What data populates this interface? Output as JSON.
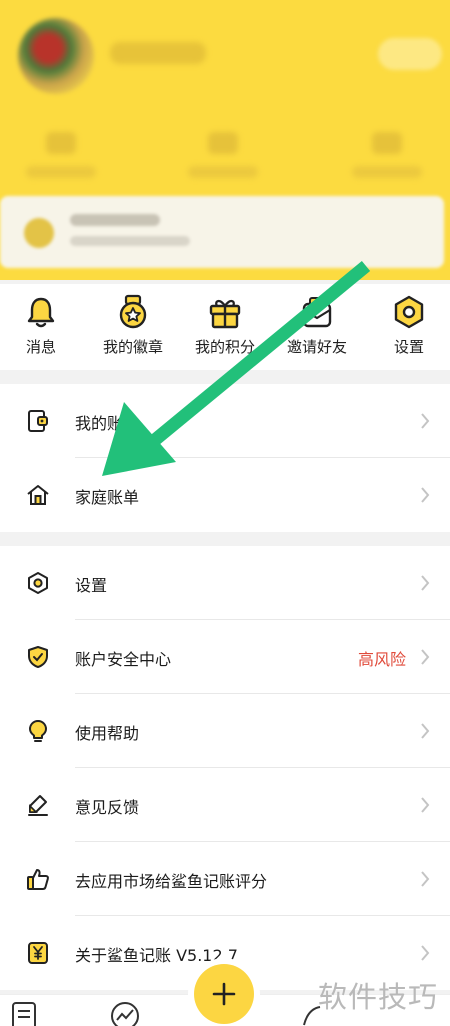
{
  "colors": {
    "brand_yellow": "#fcdb40",
    "risk_red": "#e04a3a",
    "annotation_arrow": "#22c07a"
  },
  "quick_actions": [
    {
      "label": "消息",
      "icon": "bell-icon"
    },
    {
      "label": "我的徽章",
      "icon": "medal-icon"
    },
    {
      "label": "我的积分",
      "icon": "gift-icon"
    },
    {
      "label": "邀请好友",
      "icon": "invite-icon"
    },
    {
      "label": "设置",
      "icon": "hexagon-settings-icon"
    }
  ],
  "menu_group_1": [
    {
      "label": "我的账本",
      "icon": "ledger-icon"
    },
    {
      "label": "家庭账单",
      "icon": "house-icon"
    }
  ],
  "menu_group_2": [
    {
      "label": "设置",
      "icon": "hexagon-settings-icon"
    },
    {
      "label": "账户安全中心",
      "icon": "shield-check-icon",
      "badge": "高风险"
    },
    {
      "label": "使用帮助",
      "icon": "lightbulb-icon"
    },
    {
      "label": "意见反馈",
      "icon": "pencil-icon"
    },
    {
      "label": "去应用市场给鲨鱼记账评分",
      "icon": "thumbs-up-icon"
    },
    {
      "label": "关于鲨鱼记账 V5.12.7",
      "icon": "yen-icon"
    }
  ],
  "tabbar": {
    "center_icon": "plus-icon"
  },
  "watermark": "软件技巧"
}
